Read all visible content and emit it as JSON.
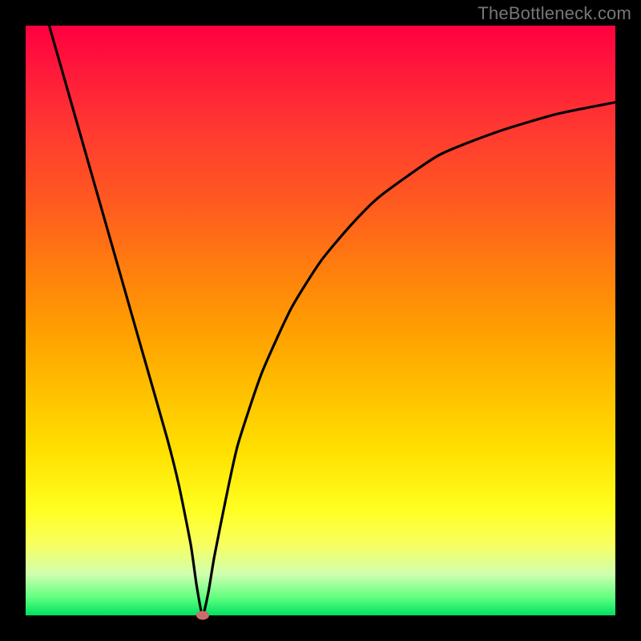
{
  "watermark": "TheBottleneck.com",
  "chart_data": {
    "type": "line",
    "title": "",
    "xlabel": "",
    "ylabel": "",
    "xlim": [
      0,
      100
    ],
    "ylim": [
      0,
      100
    ],
    "grid": false,
    "legend": false,
    "series": [
      {
        "name": "bottleneck-curve",
        "x": [
          4,
          8,
          12,
          16,
          20,
          24,
          26,
          28,
          29,
          30,
          31,
          32,
          34,
          36,
          40,
          45,
          50,
          55,
          60,
          70,
          80,
          90,
          100
        ],
        "values": [
          100,
          86,
          72,
          58,
          44,
          30,
          22,
          12,
          5,
          0,
          4,
          10,
          20,
          29,
          41,
          52,
          60,
          66,
          71,
          78,
          82,
          85,
          87
        ]
      }
    ],
    "annotations": [
      {
        "name": "min-marker",
        "x": 30,
        "y": 0
      }
    ],
    "background_gradient": {
      "top": "#ff0040",
      "mid": "#ffe000",
      "bottom": "#00e060"
    }
  }
}
